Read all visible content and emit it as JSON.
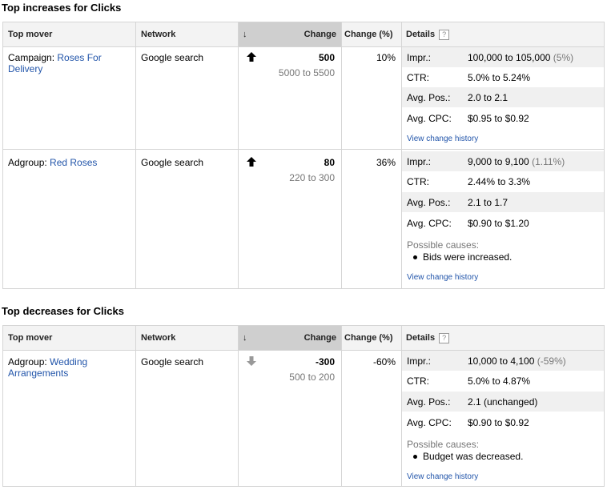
{
  "increases": {
    "title": "Top increases for Clicks",
    "headers": {
      "mover": "Top mover",
      "network": "Network",
      "sort_indicator": "↓",
      "change": "Change",
      "change_pct": "Change (%)",
      "details": "Details",
      "help": "?"
    },
    "rows": [
      {
        "type_label": "Campaign:",
        "name_line1": "Roses For",
        "name_line2": "Delivery",
        "network": "Google search",
        "direction": "up",
        "change": "500",
        "range": "5000 to 5500",
        "change_pct": "10%",
        "details": {
          "impr_label": "Impr.:",
          "impr_value": "100,000 to 105,000",
          "impr_pct": "(5%)",
          "ctr_label": "CTR:",
          "ctr_value": "5.0% to 5.24%",
          "pos_label": "Avg. Pos.:",
          "pos_value": "2.0 to 2.1",
          "cpc_label": "Avg. CPC:",
          "cpc_value": "$0.95 to $0.92"
        },
        "history_link": "View change history"
      },
      {
        "type_label": "Adgroup:",
        "name_line1": "Red Roses",
        "name_line2": "",
        "network": "Google search",
        "direction": "up",
        "change": "80",
        "range": "220 to 300",
        "change_pct": "36%",
        "details": {
          "impr_label": "Impr.:",
          "impr_value": "9,000 to 9,100",
          "impr_pct": "(1.11%)",
          "ctr_label": "CTR:",
          "ctr_value": "2.44% to 3.3%",
          "pos_label": "Avg. Pos.:",
          "pos_value": "2.1 to 1.7",
          "cpc_label": "Avg. CPC:",
          "cpc_value": "$0.90 to $1.20"
        },
        "causes_title": "Possible causes:",
        "cause": "Bids were increased.",
        "history_link": "View change history"
      }
    ]
  },
  "decreases": {
    "title": "Top decreases for Clicks",
    "headers": {
      "mover": "Top mover",
      "network": "Network",
      "sort_indicator": "↓",
      "change": "Change",
      "change_pct": "Change (%)",
      "details": "Details",
      "help": "?"
    },
    "rows": [
      {
        "type_label": "Adgroup:",
        "name_line1": "Wedding",
        "name_line2": "Arrangements",
        "network": "Google search",
        "direction": "down",
        "change": "-300",
        "range": "500 to 200",
        "change_pct": "-60%",
        "details": {
          "impr_label": "Impr.:",
          "impr_value": "10,000 to 4,100",
          "impr_pct": "(-59%)",
          "ctr_label": "CTR:",
          "ctr_value": "5.0% to 4.87%",
          "pos_label": "Avg. Pos.:",
          "pos_value": "2.1 (unchanged)",
          "cpc_label": "Avg. CPC:",
          "cpc_value": "$0.90 to $0.92"
        },
        "causes_title": "Possible causes:",
        "cause": "Budget was decreased.",
        "history_link": "View change history"
      }
    ]
  }
}
